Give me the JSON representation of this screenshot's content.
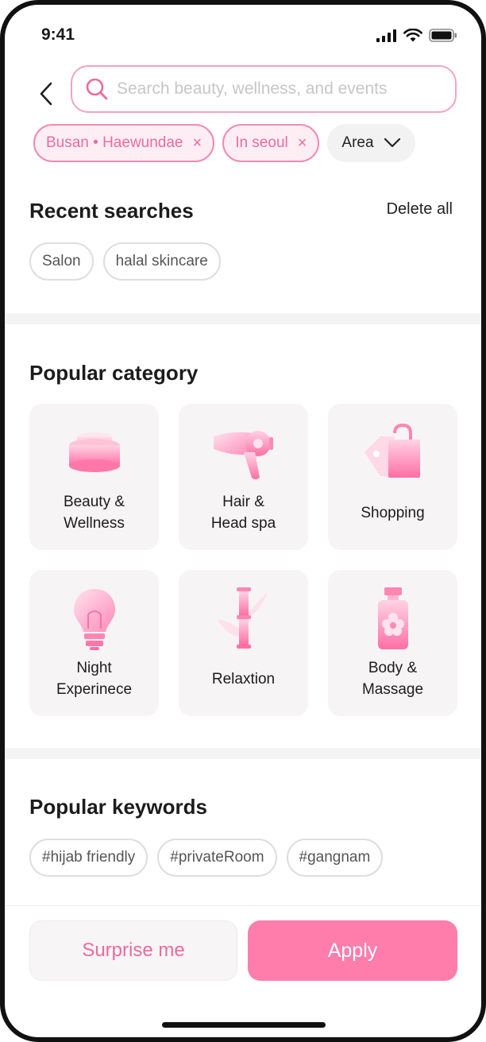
{
  "status": {
    "time": "9:41"
  },
  "search": {
    "placeholder": "Search beauty, wellness, and events"
  },
  "filters": [
    {
      "label": "Busan • Haewundae",
      "remove": "×"
    },
    {
      "label": "In seoul",
      "remove": "×"
    }
  ],
  "area_filter": {
    "label": "Area"
  },
  "recent": {
    "title": "Recent searches",
    "delete_all": "Delete all",
    "items": [
      "Salon",
      "halal skincare"
    ]
  },
  "categories": {
    "title": "Popular category",
    "items": [
      {
        "label": "Beauty &\nWellness",
        "icon": "cream-jar-icon"
      },
      {
        "label": "Hair &\nHead spa",
        "icon": "hair-dryer-icon"
      },
      {
        "label": "Shopping",
        "icon": "shopping-bag-icon"
      },
      {
        "label": "Night\nExperinece",
        "icon": "light-bulb-icon"
      },
      {
        "label": "Relaxtion",
        "icon": "bamboo-icon"
      },
      {
        "label": "Body &\nMassage",
        "icon": "oil-bottle-icon"
      }
    ]
  },
  "keywords": {
    "title": "Popular keywords",
    "items": [
      "#hijab friendly",
      "#privateRoom",
      "#gangnam"
    ]
  },
  "actions": {
    "surprise": "Surprise me",
    "apply": "Apply"
  },
  "colors": {
    "accent": "#FF7DAB",
    "accent_text": "#EE6A9D",
    "chip_bg": "#FDEEF4"
  }
}
